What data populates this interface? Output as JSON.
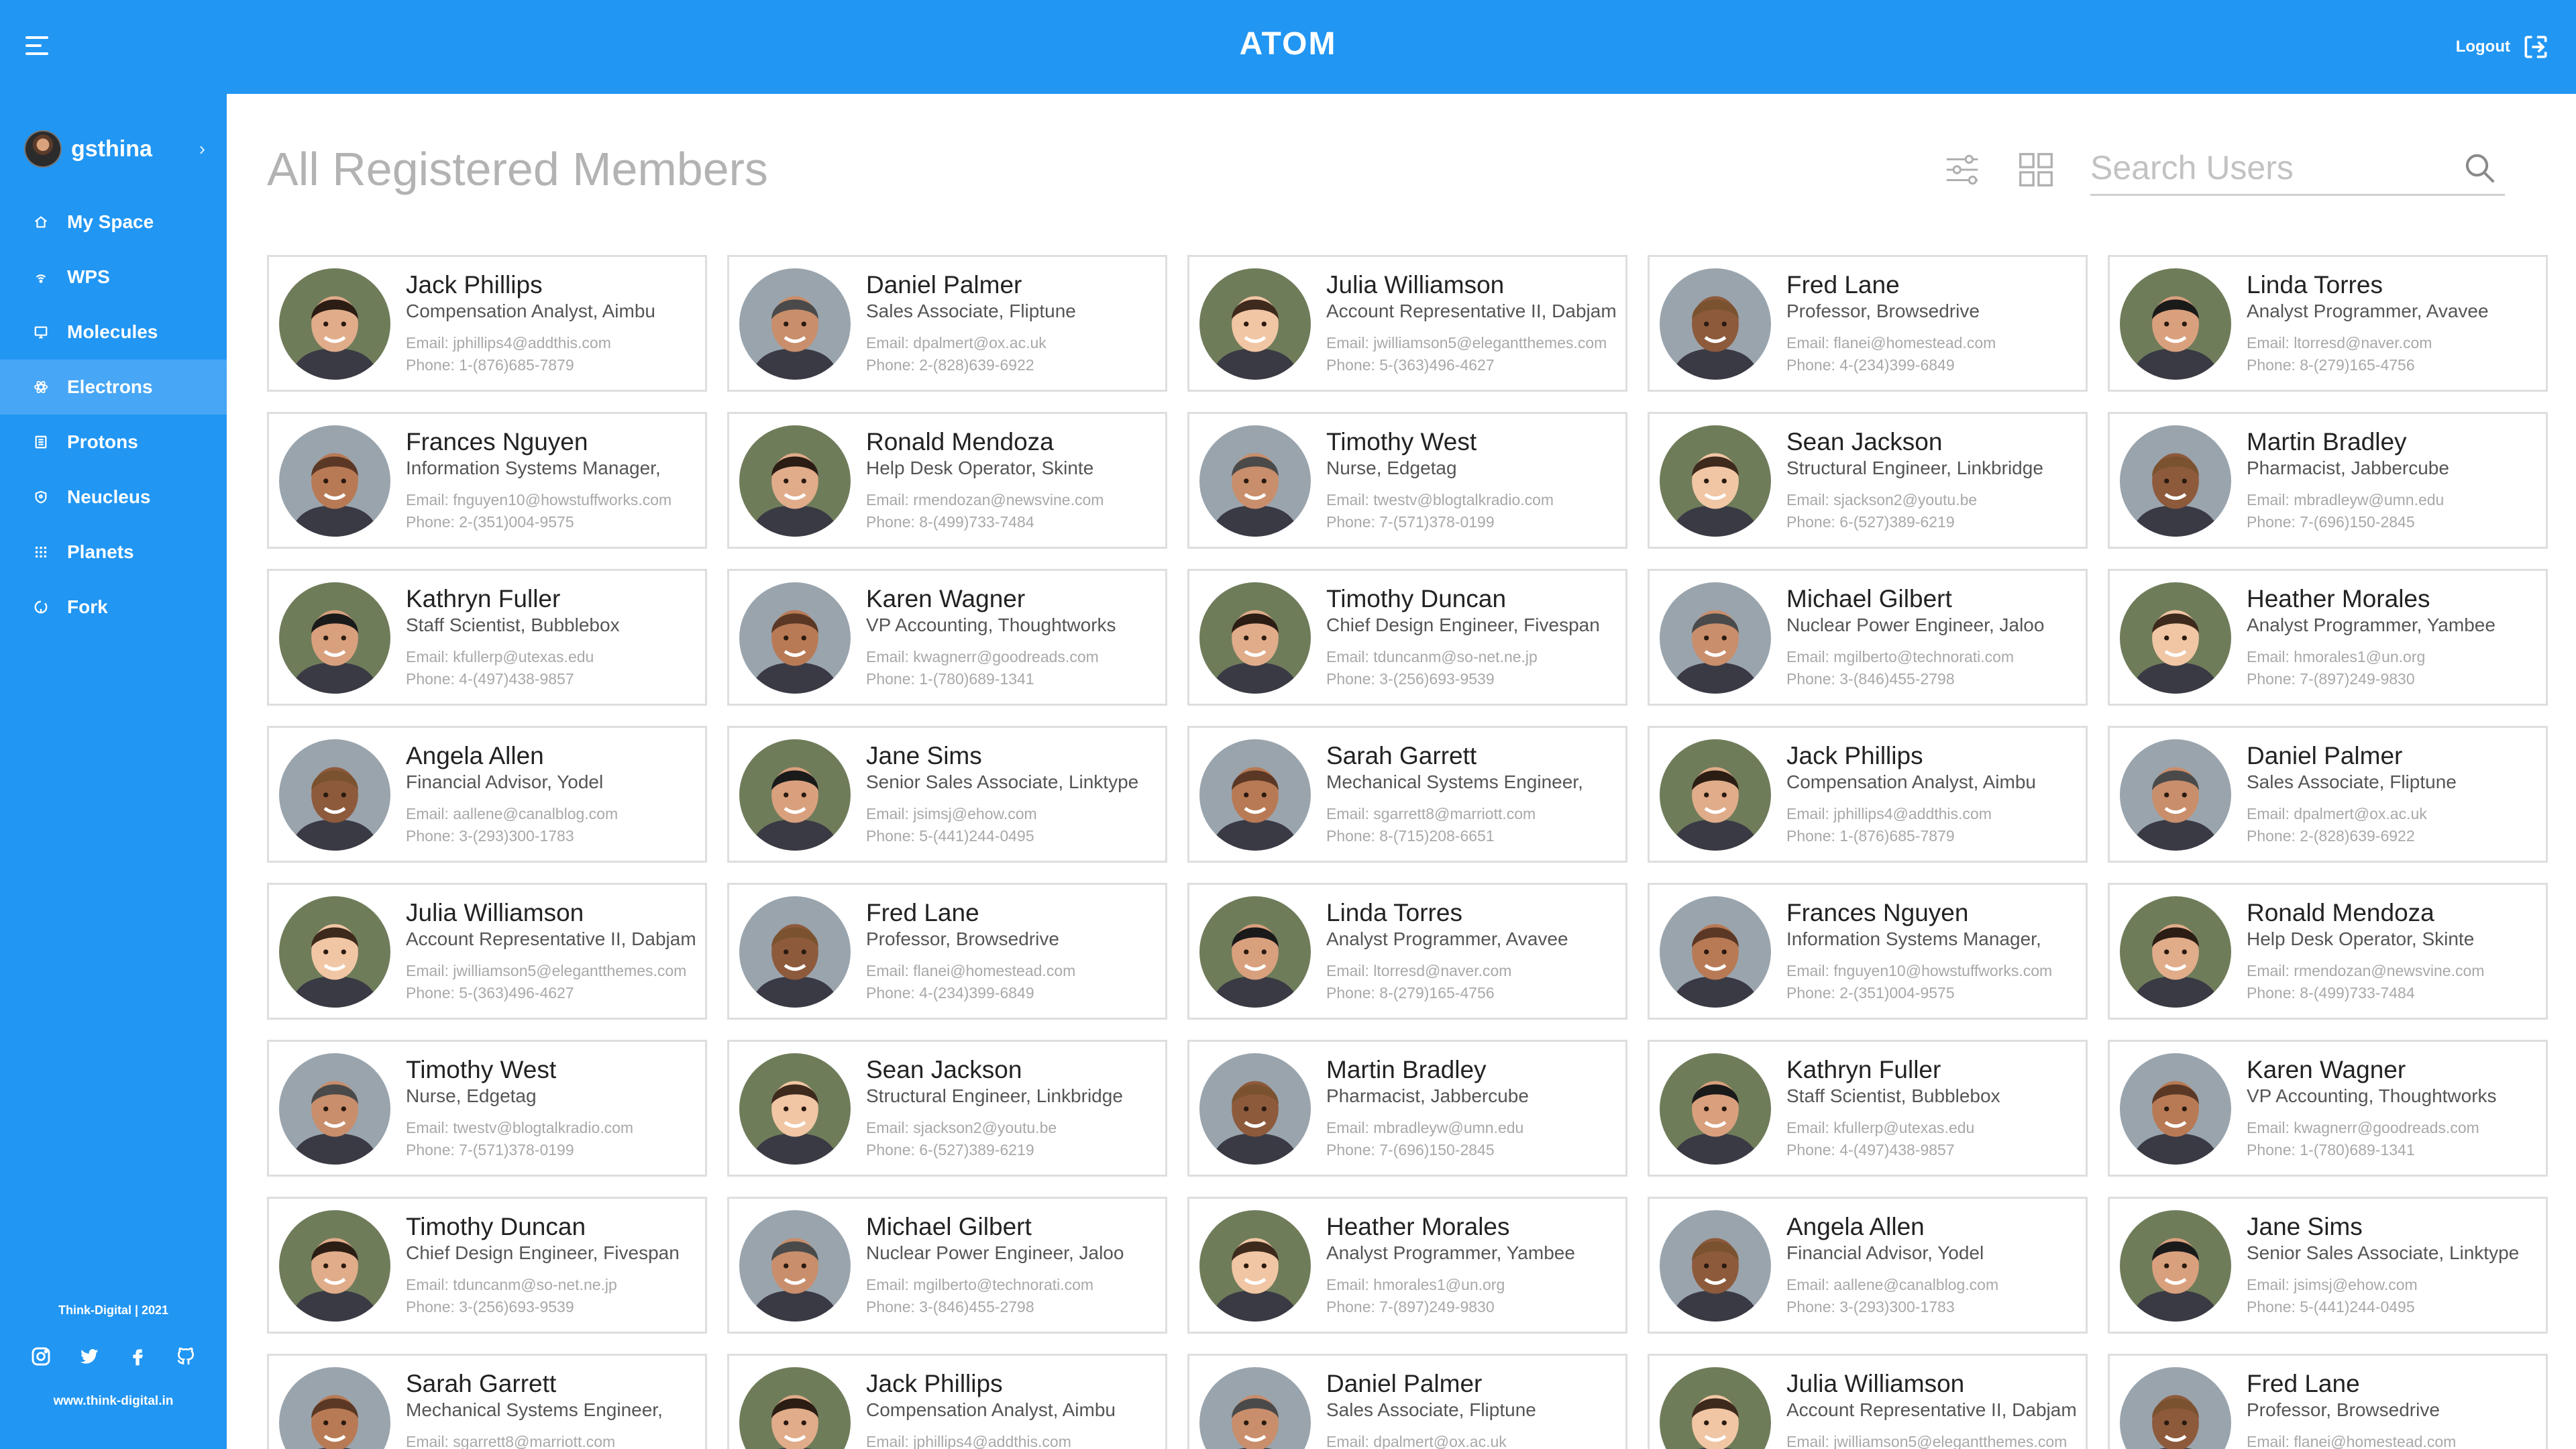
{
  "header": {
    "title": "ATOM",
    "logout_label": "Logout"
  },
  "sidebar": {
    "username": "gsthina",
    "items": [
      {
        "label": "My Space",
        "icon": "home-icon"
      },
      {
        "label": "WPS",
        "icon": "wifi-icon"
      },
      {
        "label": "Molecules",
        "icon": "monitor-icon"
      },
      {
        "label": "Electrons",
        "icon": "atom-icon",
        "active": true
      },
      {
        "label": "Protons",
        "icon": "list-icon"
      },
      {
        "label": "Neucleus",
        "icon": "shield-icon"
      },
      {
        "label": "Planets",
        "icon": "dots-grid-icon"
      },
      {
        "label": "Fork",
        "icon": "fork-icon"
      }
    ],
    "footer": {
      "copyright": "Think-Digital | 2021",
      "website": "www.think-digital.in"
    }
  },
  "main": {
    "title": "All Registered Members",
    "search_placeholder": "Search Users",
    "members": [
      {
        "name": "Jack Phillips",
        "role": "Compensation Analyst, Aimbu",
        "email": "Email: jphillips4@addthis.com",
        "phone": "Phone: 1-(876)685-7879"
      },
      {
        "name": "Daniel Palmer",
        "role": "Sales Associate, Fliptune",
        "email": "Email: dpalmert@ox.ac.uk",
        "phone": "Phone: 2-(828)639-6922"
      },
      {
        "name": "Julia Williamson",
        "role": "Account Representative II, Dabjam",
        "email": "Email: jwilliamson5@elegantthemes.com",
        "phone": "Phone: 5-(363)496-4627"
      },
      {
        "name": "Fred Lane",
        "role": "Professor, Browsedrive",
        "email": "Email: flanei@homestead.com",
        "phone": "Phone: 4-(234)399-6849"
      },
      {
        "name": "Linda Torres",
        "role": "Analyst Programmer, Avavee",
        "email": "Email: ltorresd@naver.com",
        "phone": "Phone: 8-(279)165-4756"
      },
      {
        "name": "Frances Nguyen",
        "role": "Information Systems Manager,",
        "email": "Email: fnguyen10@howstuffworks.com",
        "phone": "Phone: 2-(351)004-9575"
      },
      {
        "name": "Ronald Mendoza",
        "role": "Help Desk Operator, Skinte",
        "email": "Email: rmendozan@newsvine.com",
        "phone": "Phone: 8-(499)733-7484"
      },
      {
        "name": "Timothy West",
        "role": "Nurse, Edgetag",
        "email": "Email: twestv@blogtalkradio.com",
        "phone": "Phone: 7-(571)378-0199"
      },
      {
        "name": "Sean Jackson",
        "role": "Structural Engineer, Linkbridge",
        "email": "Email: sjackson2@youtu.be",
        "phone": "Phone: 6-(527)389-6219"
      },
      {
        "name": "Martin Bradley",
        "role": "Pharmacist, Jabbercube",
        "email": "Email: mbradleyw@umn.edu",
        "phone": "Phone: 7-(696)150-2845"
      },
      {
        "name": "Kathryn Fuller",
        "role": "Staff Scientist, Bubblebox",
        "email": "Email: kfullerp@utexas.edu",
        "phone": "Phone: 4-(497)438-9857"
      },
      {
        "name": "Karen Wagner",
        "role": "VP Accounting, Thoughtworks",
        "email": "Email: kwagnerr@goodreads.com",
        "phone": "Phone: 1-(780)689-1341"
      },
      {
        "name": "Timothy Duncan",
        "role": "Chief Design Engineer, Fivespan",
        "email": "Email: tduncanm@so-net.ne.jp",
        "phone": "Phone: 3-(256)693-9539"
      },
      {
        "name": "Michael Gilbert",
        "role": "Nuclear Power Engineer, Jaloo",
        "email": "Email: mgilberto@technorati.com",
        "phone": "Phone: 3-(846)455-2798"
      },
      {
        "name": "Heather Morales",
        "role": "Analyst Programmer, Yambee",
        "email": "Email: hmorales1@un.org",
        "phone": "Phone: 7-(897)249-9830"
      },
      {
        "name": "Angela Allen",
        "role": "Financial Advisor, Yodel",
        "email": "Email: aallene@canalblog.com",
        "phone": "Phone: 3-(293)300-1783"
      },
      {
        "name": "Jane Sims",
        "role": "Senior Sales Associate, Linktype",
        "email": "Email: jsimsj@ehow.com",
        "phone": "Phone: 5-(441)244-0495"
      },
      {
        "name": "Sarah Garrett",
        "role": "Mechanical Systems Engineer,",
        "email": "Email: sgarrett8@marriott.com",
        "phone": "Phone: 8-(715)208-6651"
      },
      {
        "name": "Jack Phillips",
        "role": "Compensation Analyst, Aimbu",
        "email": "Email: jphillips4@addthis.com",
        "phone": "Phone: 1-(876)685-7879"
      },
      {
        "name": "Daniel Palmer",
        "role": "Sales Associate, Fliptune",
        "email": "Email: dpalmert@ox.ac.uk",
        "phone": "Phone: 2-(828)639-6922"
      },
      {
        "name": "Julia Williamson",
        "role": "Account Representative II, Dabjam",
        "email": "Email: jwilliamson5@elegantthemes.com",
        "phone": "Phone: 5-(363)496-4627"
      },
      {
        "name": "Fred Lane",
        "role": "Professor, Browsedrive",
        "email": "Email: flanei@homestead.com",
        "phone": "Phone: 4-(234)399-6849"
      },
      {
        "name": "Linda Torres",
        "role": "Analyst Programmer, Avavee",
        "email": "Email: ltorresd@naver.com",
        "phone": "Phone: 8-(279)165-4756"
      },
      {
        "name": "Frances Nguyen",
        "role": "Information Systems Manager,",
        "email": "Email: fnguyen10@howstuffworks.com",
        "phone": "Phone: 2-(351)004-9575"
      },
      {
        "name": "Ronald Mendoza",
        "role": "Help Desk Operator, Skinte",
        "email": "Email: rmendozan@newsvine.com",
        "phone": "Phone: 8-(499)733-7484"
      },
      {
        "name": "Timothy West",
        "role": "Nurse, Edgetag",
        "email": "Email: twestv@blogtalkradio.com",
        "phone": "Phone: 7-(571)378-0199"
      },
      {
        "name": "Sean Jackson",
        "role": "Structural Engineer, Linkbridge",
        "email": "Email: sjackson2@youtu.be",
        "phone": "Phone: 6-(527)389-6219"
      },
      {
        "name": "Martin Bradley",
        "role": "Pharmacist, Jabbercube",
        "email": "Email: mbradleyw@umn.edu",
        "phone": "Phone: 7-(696)150-2845"
      },
      {
        "name": "Kathryn Fuller",
        "role": "Staff Scientist, Bubblebox",
        "email": "Email: kfullerp@utexas.edu",
        "phone": "Phone: 4-(497)438-9857"
      },
      {
        "name": "Karen Wagner",
        "role": "VP Accounting, Thoughtworks",
        "email": "Email: kwagnerr@goodreads.com",
        "phone": "Phone: 1-(780)689-1341"
      },
      {
        "name": "Timothy Duncan",
        "role": "Chief Design Engineer, Fivespan",
        "email": "Email: tduncanm@so-net.ne.jp",
        "phone": "Phone: 3-(256)693-9539"
      },
      {
        "name": "Michael Gilbert",
        "role": "Nuclear Power Engineer, Jaloo",
        "email": "Email: mgilberto@technorati.com",
        "phone": "Phone: 3-(846)455-2798"
      },
      {
        "name": "Heather Morales",
        "role": "Analyst Programmer, Yambee",
        "email": "Email: hmorales1@un.org",
        "phone": "Phone: 7-(897)249-9830"
      },
      {
        "name": "Angela Allen",
        "role": "Financial Advisor, Yodel",
        "email": "Email: aallene@canalblog.com",
        "phone": "Phone: 3-(293)300-1783"
      },
      {
        "name": "Jane Sims",
        "role": "Senior Sales Associate, Linktype",
        "email": "Email: jsimsj@ehow.com",
        "phone": "Phone: 5-(441)244-0495"
      },
      {
        "name": "Sarah Garrett",
        "role": "Mechanical Systems Engineer,",
        "email": "Email: sgarrett8@marriott.com",
        "phone": ""
      },
      {
        "name": "Jack Phillips",
        "role": "Compensation Analyst, Aimbu",
        "email": "Email: jphillips4@addthis.com",
        "phone": ""
      },
      {
        "name": "Daniel Palmer",
        "role": "Sales Associate, Fliptune",
        "email": "Email: dpalmert@ox.ac.uk",
        "phone": ""
      },
      {
        "name": "Julia Williamson",
        "role": "Account Representative II, Dabjam",
        "email": "Email: jwilliamson5@elegantthemes.com",
        "phone": ""
      },
      {
        "name": "Fred Lane",
        "role": "Professor, Browsedrive",
        "email": "Email: flanei@homestead.com",
        "phone": ""
      }
    ]
  },
  "colors": {
    "primary": "#2196f3",
    "active_nav": "#47a6f5",
    "title_gray": "#b3b3b3"
  }
}
